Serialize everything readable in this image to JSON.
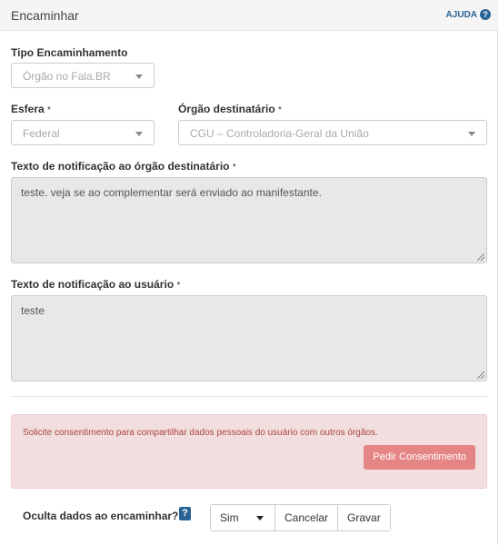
{
  "header": {
    "title": "Encaminhar",
    "help_label": "AJUDA",
    "help_icon": "?"
  },
  "tipo": {
    "label": "Tipo Encaminhamento",
    "value": "Órgão no Fala.BR"
  },
  "esfera": {
    "label": "Esfera",
    "required": "*",
    "value": "Federal"
  },
  "orgao": {
    "label": "Órgão destinatário",
    "required": "*",
    "value": "CGU – Controladoria-Geral da União"
  },
  "texto_orgao": {
    "label": "Texto de notificação ao órgão destinatário",
    "required": "*",
    "value": "teste. veja se ao complementar será enviado ao manifestante."
  },
  "texto_usuario": {
    "label": "Texto de notificação ao usuário",
    "required": "*",
    "value": "teste"
  },
  "alert": {
    "message": "Solicite consentimento para compartilhar dados pessoais do usuário com outros órgãos.",
    "button": "Pedir Consentimento"
  },
  "bottom": {
    "question": "Oculta dados ao encaminhar?",
    "help_icon": "?",
    "select_value": "Sim",
    "cancel": "Cancelar",
    "save": "Gravar"
  },
  "colors": {
    "alert_bg": "#f2dede",
    "alert_text": "#a94442",
    "alert_button": "#e58585",
    "help_blue": "#2a6496"
  }
}
